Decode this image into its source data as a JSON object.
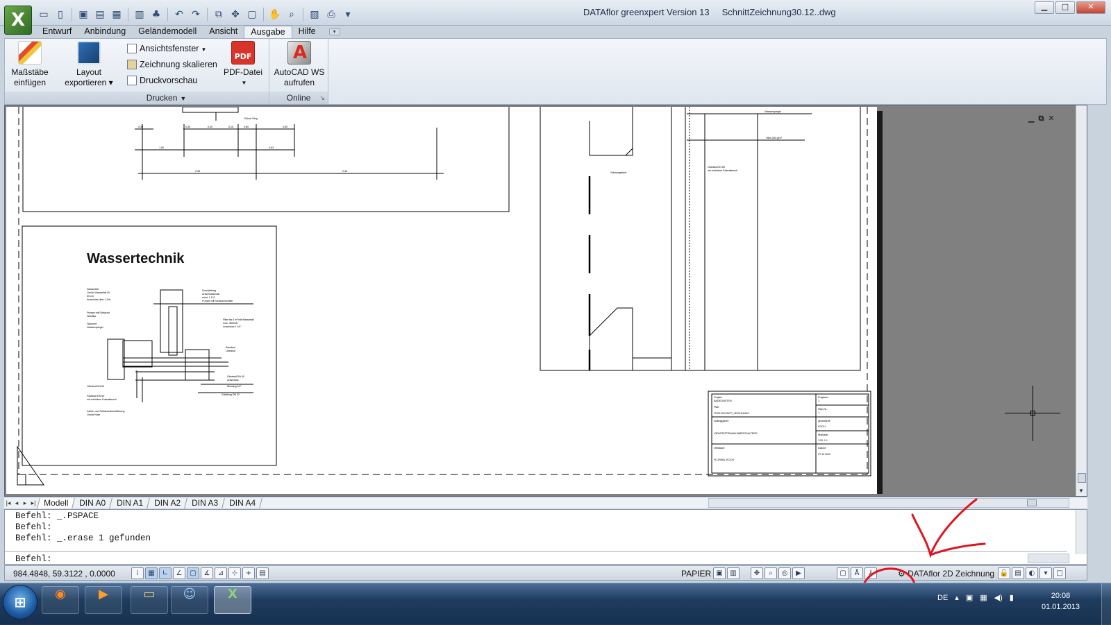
{
  "window": {
    "app_name": "DATAflor greenxpert Version 13",
    "file_name": "SchnittZeichnung30.12..dwg",
    "min_label": "▁",
    "max_label": "□",
    "close_label": "✕"
  },
  "menu_tabs": [
    {
      "label": "Entwurf"
    },
    {
      "label": "Anbindung"
    },
    {
      "label": "Geländemodell"
    },
    {
      "label": "Ansicht"
    },
    {
      "label": "Ausgabe",
      "active": true
    },
    {
      "label": "Hilfe"
    }
  ],
  "ribbon": {
    "massstaebe": "Maßstäbe\neinfügen",
    "layout_export": "Layout\nexportieren ▾",
    "ansichtsfenster": "Ansichtsfenster",
    "zeichnung_skalieren": "Zeichnung skalieren",
    "druckvorschau": "Druckvorschau",
    "pdf_datei": "PDF-Datei",
    "pdf_icon_text": "PDF",
    "autocad_ws": "AutoCAD WS\naufrufen",
    "group_drucken": "Drucken",
    "group_online": "Online"
  },
  "drawing": {
    "section_title": "Wassertechnik",
    "dims": [
      "0.30",
      "0.30",
      "0.30",
      "0.15",
      "0.80",
      "0.50",
      "1.00",
      "0.63",
      "2.35",
      "2.45"
    ],
    "top_label": "Grüner Weg",
    "right_labels": [
      "Wasserspiegel",
      "Vlies 300 g/m²",
      "Überlauf DN 50\nmit erhöhtem Folienflansch",
      "Schwingsteine"
    ],
    "wasser_labels": [
      "Wasserfall\nGroße Wasserfall 40\n30 cm\nAnschluss über 1 Zoll",
      "Druckleitung\nAnschlussdruck\nmind. 1 1/4\"\nPumpe mit Schlauchschelle",
      "Pumpe mit Schlauch\nSiebfilter",
      "Skimmer\nWasserspiegel",
      "Filter bis 4 m³ mit Wasserfall\nmax. 3500 l/h\nAnschluss 1 1/4\"",
      "Bachlauf\nÜberlauf",
      "Überlauf DN 50",
      "Rücklauf DN 50\nmit erhöhtem Folienflansch",
      "Kabel- und Schlauchdurchführung\nGroße Kiste",
      "Überlauf DN 40\nAnschluss",
      "Messing 1/2\"",
      "Zuleitung DN 32"
    ],
    "titleblock": {
      "projekt_label": "Projekt:",
      "projekt": "BADEGARTEN",
      "plan_label": "Plan:",
      "plan": "TEICHSCHNITT_ZEICHNUNG",
      "projektnr_label": "Projektnr.:",
      "projektnr": "1",
      "plannr_label": "Plan-Nr.:",
      "plannr": "1",
      "auftraggeber_label": "Auftraggeber:",
      "auftraggeber": "VIENSTATTENWALDBERGSALTERS",
      "gezeichnet_label": "gezeichnet:",
      "gezeichnet": "KOCH",
      "massstab_label": "Maßstab:",
      "massstab": "1:20, 1:1",
      "verfasser_label": "Verfasser:",
      "verfasser": "FLORIAN_KOCH",
      "datum_label": "Datum:",
      "datum": "27.12.2012"
    }
  },
  "layout_tabs": [
    {
      "label": "Modell"
    },
    {
      "label": "DIN A0"
    },
    {
      "label": "DIN A1"
    },
    {
      "label": "DIN A2"
    },
    {
      "label": "DIN A3"
    },
    {
      "label": "DIN A4"
    }
  ],
  "command": {
    "lines": [
      "Befehl: _.PSPACE",
      "Befehl:",
      "Befehl: _.erase 1 gefunden"
    ],
    "prompt": "Befehl:"
  },
  "status": {
    "coords": "984.4848, 59.3122 , 0.0000",
    "papier": "PAPIER",
    "workspace": "DATAflor 2D Zeichnung"
  },
  "taskbar": {
    "language": "DE",
    "time": "20:08",
    "date": "01.01.2013"
  },
  "annotation_color": "#e0141e",
  "accent_color": "#d9342b"
}
